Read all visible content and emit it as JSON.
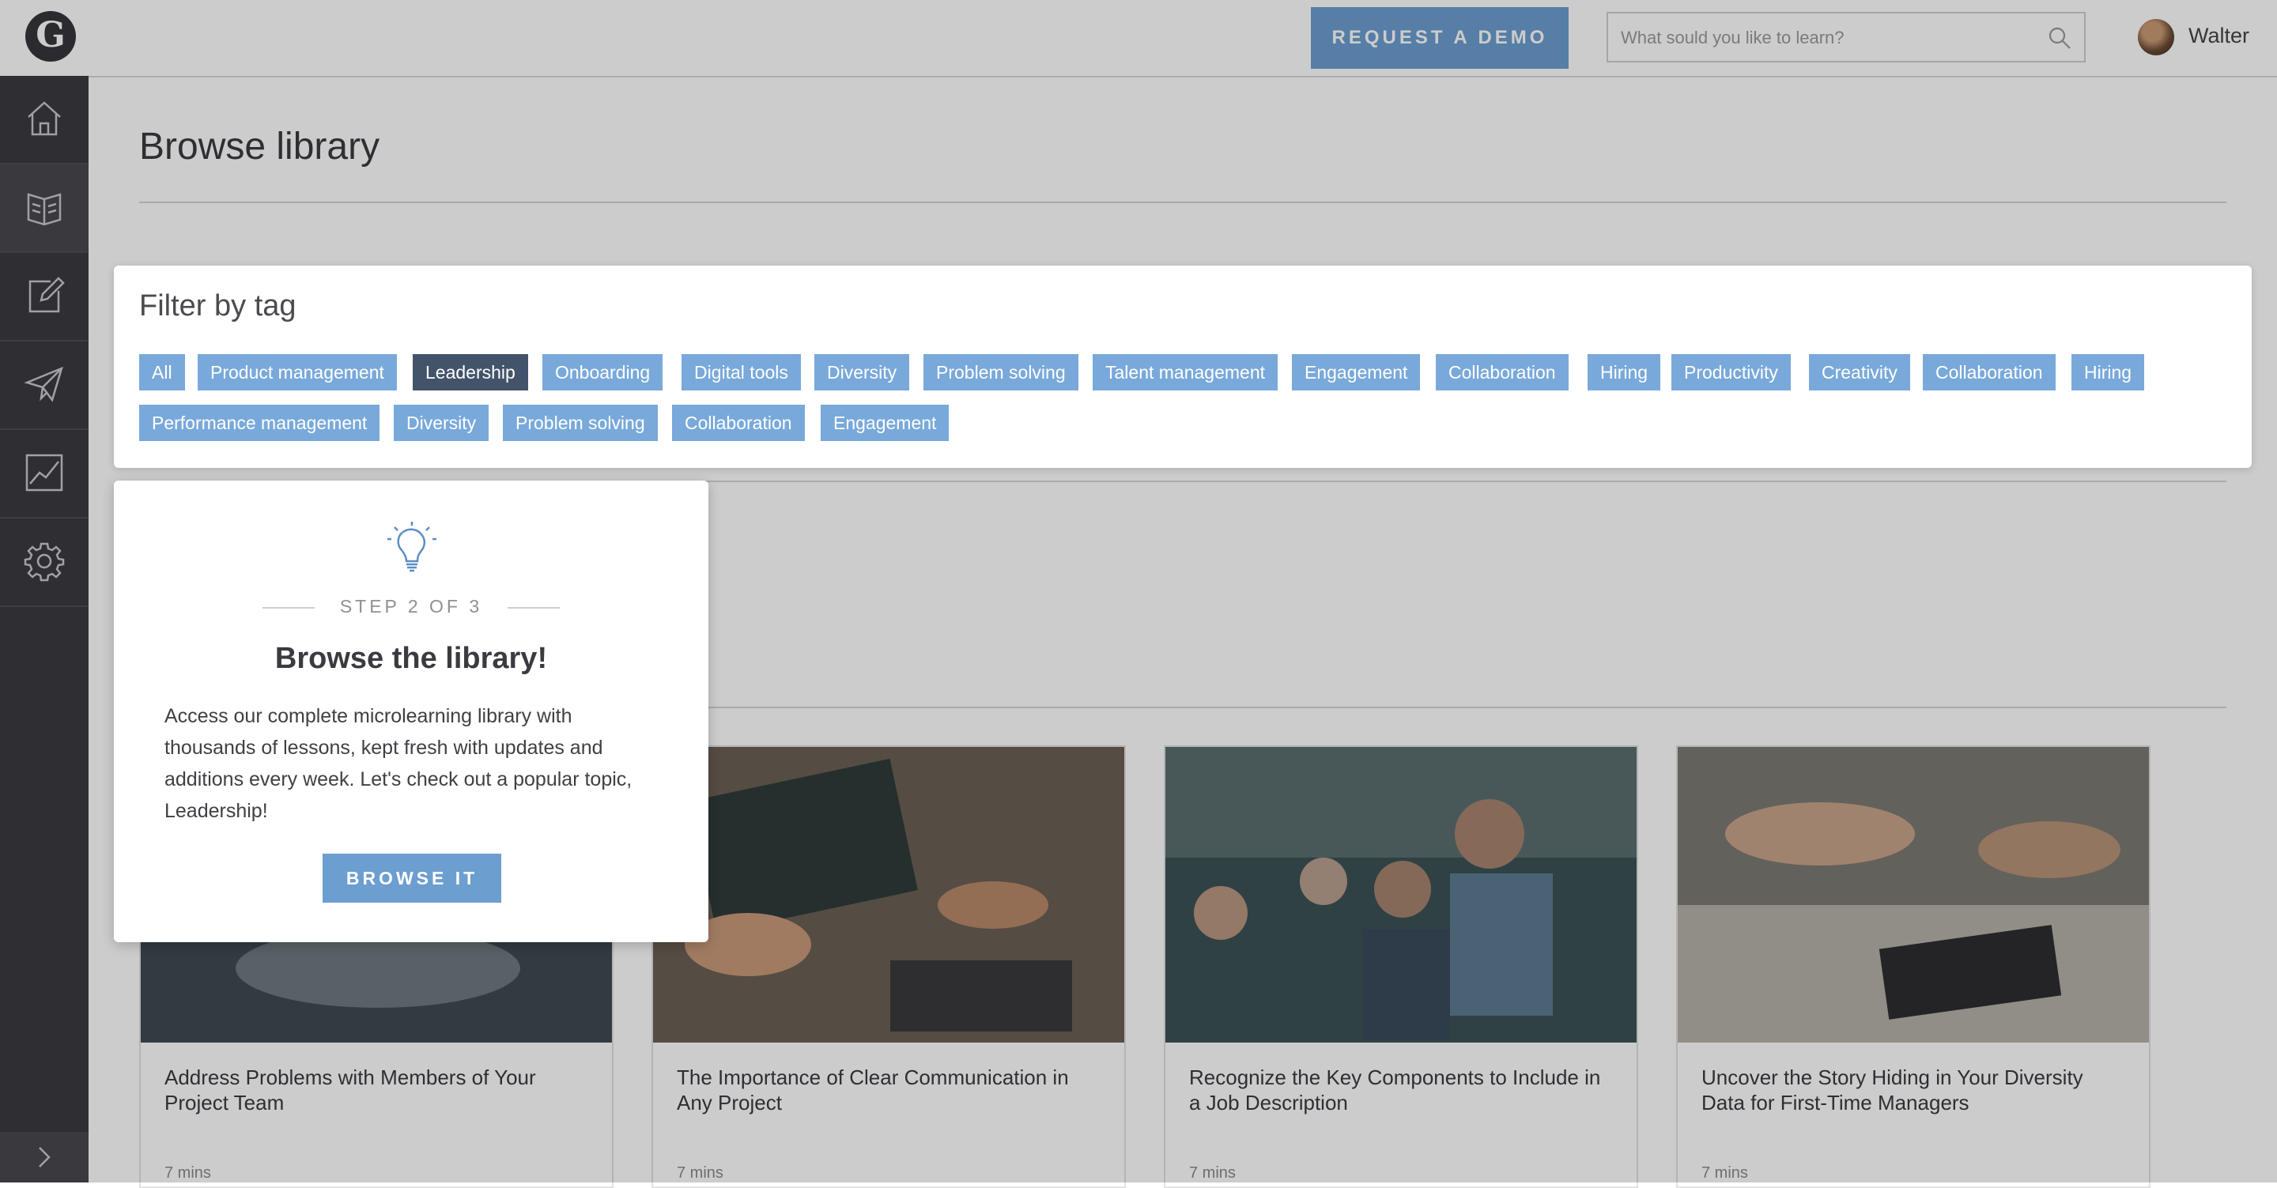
{
  "app": {
    "logo_letter": "G"
  },
  "header": {
    "demo_button": "REQUEST A DEMO",
    "search_placeholder": "What sould you like to learn?",
    "user_name": "Walter"
  },
  "sidebar": {
    "items": [
      {
        "name": "home",
        "icon": "home-icon",
        "active": false
      },
      {
        "name": "library",
        "icon": "book-icon",
        "active": true
      },
      {
        "name": "create",
        "icon": "edit-icon",
        "active": false
      },
      {
        "name": "send",
        "icon": "paper-plane-icon",
        "active": false
      },
      {
        "name": "analytics",
        "icon": "chart-icon",
        "active": false
      },
      {
        "name": "settings",
        "icon": "gear-icon",
        "active": false
      }
    ]
  },
  "page": {
    "title": "Browse library"
  },
  "filter": {
    "title": "Filter by tag",
    "tags": [
      "All",
      "Product management",
      "Leadership",
      "Onboarding",
      "Digital tools",
      "Diversity",
      "Problem solving",
      "Talent management",
      "Engagement",
      "Collaboration",
      "Hiring",
      "Productivity",
      "Creativity",
      "Collaboration",
      "Hiring",
      "Performance management",
      "Diversity",
      "Problem solving",
      "Collaboration",
      "Engagement"
    ],
    "selected": "Leadership"
  },
  "cards": [
    {
      "title": "Address Problems with Members of Your Project Team",
      "meta": "7 mins"
    },
    {
      "title": "The Importance of Clear Communication in Any Project",
      "meta": "7 mins"
    },
    {
      "title": "Recognize the Key Components to Include in a Job Description",
      "meta": "7 mins"
    },
    {
      "title": "Uncover the Story Hiding in Your Diversity Data for First-Time Managers",
      "meta": "7 mins"
    }
  ],
  "popup": {
    "step": "STEP 2 OF 3",
    "title": "Browse the library!",
    "body": "Access our complete microlearning library with thousands of lessons, kept fresh with updates and additions every week. Let's check out a popular topic, Leadership!",
    "button": "BROWSE IT"
  },
  "colors": {
    "accent": "#6c9ed0",
    "tag": "#79a9da",
    "tag_selected": "#43536a",
    "sidebar": "#3b3b40"
  }
}
